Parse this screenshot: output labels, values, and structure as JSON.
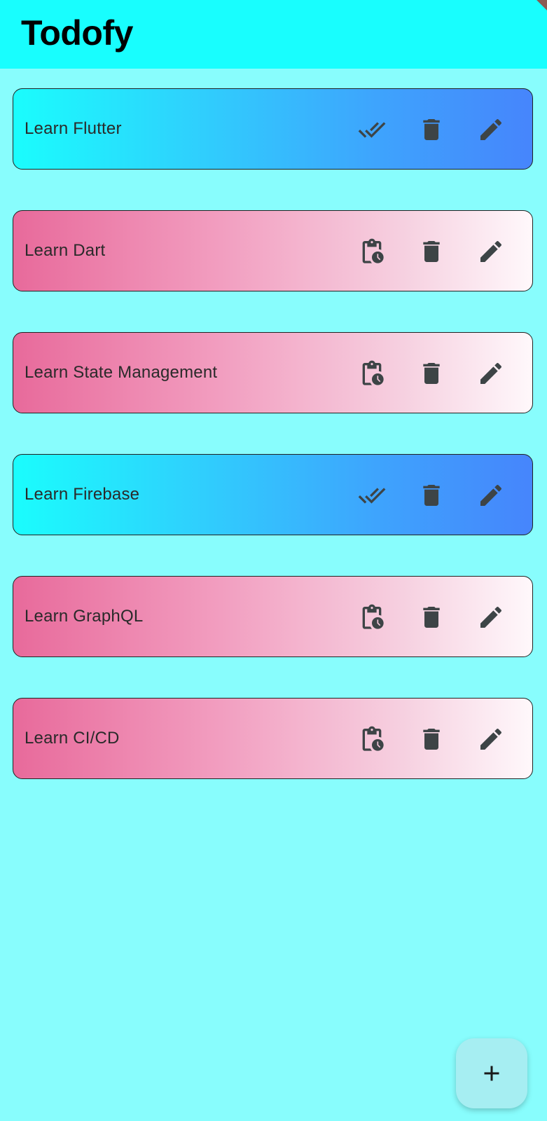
{
  "app": {
    "title": "Todofy"
  },
  "todos": [
    {
      "title": "Learn Flutter",
      "status": "done",
      "status_icon": "done-all-icon"
    },
    {
      "title": "Learn Dart",
      "status": "pending",
      "status_icon": "pending-actions-icon"
    },
    {
      "title": "Learn State Management",
      "status": "pending",
      "status_icon": "pending-actions-icon"
    },
    {
      "title": "Learn Firebase",
      "status": "done",
      "status_icon": "done-all-icon"
    },
    {
      "title": "Learn GraphQL",
      "status": "pending",
      "status_icon": "pending-actions-icon"
    },
    {
      "title": "Learn CI/CD",
      "status": "pending",
      "status_icon": "pending-actions-icon"
    }
  ],
  "icons": {
    "delete": "delete-icon",
    "edit": "edit-icon",
    "add": "add-icon"
  },
  "colors": {
    "background": "#88fdfd",
    "appbar": "#18fefe",
    "done_gradient": [
      "#1afdfd",
      "#4685fc"
    ],
    "pending_gradient": [
      "#e86a9b",
      "#fff8fb"
    ],
    "icon": "#3d4446",
    "fab": "#a6eef2"
  }
}
